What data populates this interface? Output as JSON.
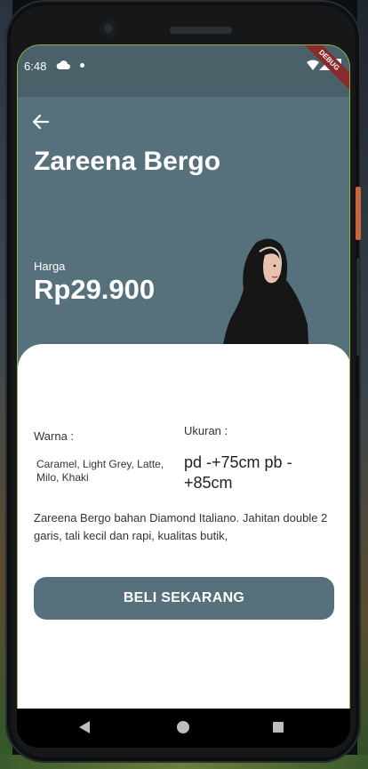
{
  "status_bar": {
    "time": "6:48",
    "icons": [
      "cloud-icon",
      "dot-icon",
      "wifi-icon",
      "signal-icon",
      "battery-icon"
    ],
    "debug_label": "DEBUG"
  },
  "header": {
    "back_icon": "arrow-left-icon",
    "title": "Zareena Bergo"
  },
  "price": {
    "label": "Harga",
    "value": "Rp29.900"
  },
  "details": {
    "color_label": "Warna :",
    "color_value": "Caramel, Light Grey, Latte, Milo, Khaki",
    "size_label": "Ukuran :",
    "size_value": "pd -+75cm pb -+85cm",
    "description": "Zareena Bergo bahan Diamond Italiano. Jahitan double 2 garis, tali kecil dan rapi, kualitas butik,"
  },
  "actions": {
    "buy_label": "BELI SEKARANG"
  },
  "nav_bar": {
    "icons": [
      "back-triangle-icon",
      "home-circle-icon",
      "recent-square-icon"
    ]
  },
  "colors": {
    "primary": "#56717b",
    "status_bar": "#4a6169",
    "card": "#ffffff",
    "text": "#333333"
  }
}
